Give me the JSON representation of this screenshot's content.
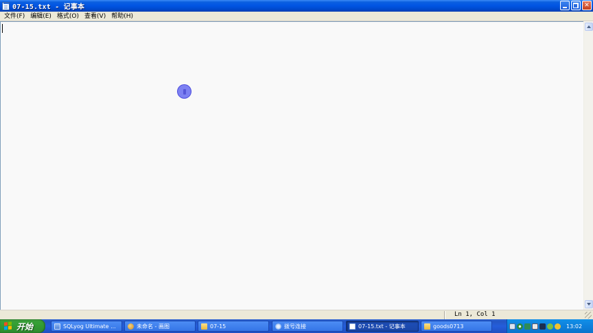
{
  "window": {
    "title": "07-15.txt - 记事本",
    "buttons": {
      "minimize_icon": "minimize-icon",
      "restore_icon": "restore-icon",
      "close_icon": "close-icon"
    }
  },
  "menu": {
    "items": [
      {
        "label": "文件(F)"
      },
      {
        "label": "编辑(E)"
      },
      {
        "label": "格式(O)"
      },
      {
        "label": "查看(V)"
      },
      {
        "label": "帮助(H)"
      }
    ]
  },
  "editor": {
    "content": ""
  },
  "statusbar": {
    "position": "Ln 1, Col 1"
  },
  "taskbar": {
    "start_label": "开始",
    "tasks": [
      {
        "label": "SQLyog Ultimate ...",
        "icon": "sqlyog-icon"
      },
      {
        "label": "未命名 - 画图",
        "icon": "paint-icon"
      },
      {
        "label": "07-15",
        "icon": "folder-icon"
      },
      {
        "label": "拨号连接",
        "icon": "dialup-icon"
      },
      {
        "label": "07-15.txt - 记事本",
        "icon": "notepad-icon",
        "active": true
      },
      {
        "label": "goods0713",
        "icon": "folder-icon"
      }
    ],
    "clock": "13:02"
  },
  "colors": {
    "titlebar": "#0054E3",
    "taskbar": "#245DDB",
    "start_button": "#35A035",
    "editor_bg": "#F9F9F9",
    "cursor_highlight": "#5A5FF0"
  }
}
